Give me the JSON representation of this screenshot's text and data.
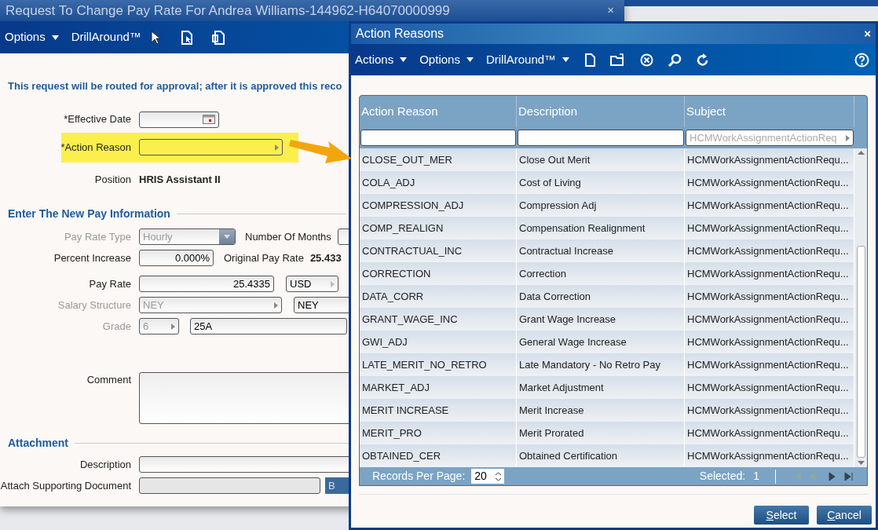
{
  "background_window": {
    "title": "Request To Change Pay Rate For Andrea Williams-144962-H64070000999",
    "close": "×",
    "menus": [
      "Options",
      "DrillAround™"
    ],
    "notice": "This request will be routed for approval; after it is approved this reco",
    "effective_date": {
      "label": "*Effective Date"
    },
    "action_reason": {
      "label": "*Action Reason",
      "highlighted": true
    },
    "position": {
      "label": "Position",
      "value": "HRIS Assistant II"
    },
    "pay_section": {
      "heading": "Enter The New Pay Information",
      "pay_rate_type": {
        "label": "Pay Rate Type",
        "value": "Hourly",
        "disabled": true
      },
      "number_of_months": {
        "label": "Number Of Months"
      },
      "percent_increase": {
        "label": "Percent Increase",
        "value": "0.000%"
      },
      "original_pay_rate": {
        "label": "Original Pay Rate",
        "value": "25.433"
      },
      "pay_rate": {
        "label": "Pay Rate",
        "value": "25.4335",
        "currency": "USD"
      },
      "salary_structure": {
        "label": "Salary Structure",
        "value": "NEY",
        "value_2": "NEY",
        "disabled": true
      },
      "grade": {
        "label": "Grade",
        "value": "6",
        "value_2": "25A",
        "disabled": true
      },
      "comment": {
        "label": "Comment"
      }
    },
    "attachment_section": {
      "heading": "Attachment",
      "description": {
        "label": "Description"
      },
      "attach": {
        "label": "Attach Supporting Document",
        "button": "B"
      }
    }
  },
  "dialog": {
    "title": "Action Reasons",
    "close": "×",
    "menus": [
      "Actions",
      "Options",
      "DrillAround™"
    ],
    "columns": [
      "Action Reason",
      "Description",
      "Subject"
    ],
    "filters": [
      {
        "kind": "text"
      },
      {
        "kind": "text"
      },
      {
        "kind": "select",
        "placeholder": "HCMWorkAssignmentActionReq"
      }
    ],
    "rows": [
      [
        "CLOSE_OUT_MER",
        "Close Out Merit",
        "HCMWorkAssignmentActionRequ..."
      ],
      [
        "COLA_ADJ",
        "Cost of Living",
        "HCMWorkAssignmentActionRequ..."
      ],
      [
        "COMPRESSION_ADJ",
        "Compression Adj",
        "HCMWorkAssignmentActionRequ..."
      ],
      [
        "COMP_REALIGN",
        "Compensation Realignment",
        "HCMWorkAssignmentActionRequ..."
      ],
      [
        "CONTRACTUAL_INC",
        "Contractual Increase",
        "HCMWorkAssignmentActionRequ..."
      ],
      [
        "CORRECTION",
        "Correction",
        "HCMWorkAssignmentActionRequ..."
      ],
      [
        "DATA_CORR",
        "Data Correction",
        "HCMWorkAssignmentActionRequ..."
      ],
      [
        "GRANT_WAGE_INC",
        "Grant Wage Increase",
        "HCMWorkAssignmentActionRequ..."
      ],
      [
        "GWI_ADJ",
        "General Wage Increase",
        "HCMWorkAssignmentActionRequ..."
      ],
      [
        "LATE_MERIT_NO_RETRO",
        "Late Mandatory - No Retro Pay",
        "HCMWorkAssignmentActionRequ..."
      ],
      [
        "MARKET_ADJ",
        "Market Adjustment",
        "HCMWorkAssignmentActionRequ..."
      ],
      [
        "MERIT INCREASE",
        "Merit Increase",
        "HCMWorkAssignmentActionRequ..."
      ],
      [
        "MERIT_PRO",
        "Merit Prorated",
        "HCMWorkAssignmentActionRequ..."
      ],
      [
        "OBTAINED_CER",
        "Obtained Certification",
        "HCMWorkAssignmentActionRequ..."
      ]
    ],
    "footer": {
      "records_label": "Records Per Page:",
      "records_value": "20",
      "selected_label": "Selected:",
      "selected_value": "1"
    },
    "buttons": [
      "Select",
      "Cancel"
    ]
  }
}
